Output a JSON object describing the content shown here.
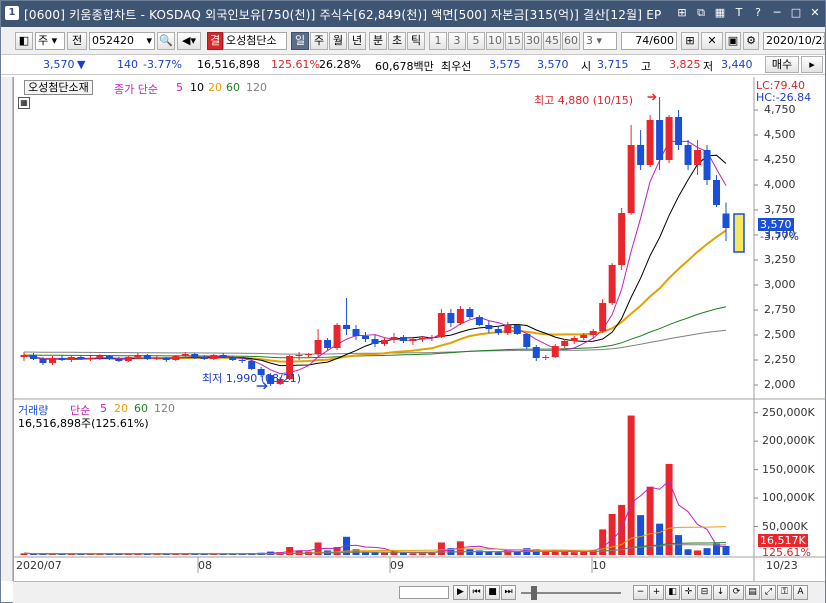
{
  "window": {
    "badge": "1",
    "title": "[0600] 키움종합차트 - KOSDAQ 외국인보유[750(천)] 주식수[62,849(천)] 액면[500] 자본금[315(억)] 결산[12월] EP"
  },
  "toolbar": {
    "market": "주",
    "prev_label": "전",
    "code": "052420",
    "stock_name": "오성첨단소",
    "name_prefix": "결",
    "periods": [
      "일",
      "주",
      "월",
      "년",
      "분",
      "초",
      "틱"
    ],
    "minutes": [
      "1",
      "3",
      "5",
      "10",
      "15",
      "30",
      "45",
      "60"
    ],
    "custom_value": "3",
    "count": "74/600",
    "date": "2020/10/23"
  },
  "quote": {
    "price": "3,570",
    "arrow": "▼",
    "change": "140",
    "change_pct": "-3.77%",
    "volume": "16,516,898",
    "vol_ratio": "125.61%",
    "turnover": "26.28%",
    "amount": "60,678백만",
    "pref_label": "최우선",
    "bid1": "3,575",
    "bid2": "3,570",
    "open_label": "시",
    "open": "3,715",
    "high_label": "고",
    "high": "3,825",
    "low_label": "저",
    "low": "3,440",
    "buy_label": "매수"
  },
  "price_panel": {
    "chip": "오성첨단소재",
    "legend_name": "종가 단순",
    "ma": [
      "5",
      "10",
      "20",
      "60",
      "120"
    ],
    "ma_colors": [
      "#c020c0",
      "#000000",
      "#e6a000",
      "#208020",
      "#808080"
    ],
    "lc": "LC:79.40",
    "hc": "HC:-26.84",
    "yticks": [
      "4,750",
      "4,500",
      "4,250",
      "4,000",
      "3,750",
      "3,500",
      "3,250",
      "3,000",
      "2,750",
      "2,500",
      "2,250",
      "2,000"
    ],
    "current_tag": "3,570",
    "current_pct": "-3.77%",
    "max_label": "최고 4,880 (10/15)",
    "min_label": "최저 1,990 (08/21)"
  },
  "volume_panel": {
    "legend_name": "거래량",
    "legend_ma": "단순",
    "ma": [
      "5",
      "20",
      "60",
      "120"
    ],
    "info": "16,516,898주(125.61%)",
    "yticks": [
      "250,000K",
      "200,000K",
      "150,000K",
      "100,000K",
      "50,000K"
    ],
    "current_tag": "16,517K",
    "current_pct": "125.61%"
  },
  "xaxis": {
    "labels": [
      "2020/07",
      "08",
      "09",
      "10",
      "10/23"
    ]
  },
  "colors": {
    "up": "#e8262b",
    "down": "#1a4fd8",
    "title_bg": "#3e5573"
  },
  "chart_data": {
    "type": "candlestick",
    "dates_from": "2020/07",
    "dates_to": "2020/10/23",
    "ohlc": [
      [
        2280,
        2330,
        2240,
        2300
      ],
      [
        2300,
        2320,
        2250,
        2260
      ],
      [
        2260,
        2280,
        2200,
        2220
      ],
      [
        2220,
        2290,
        2200,
        2270
      ],
      [
        2270,
        2300,
        2240,
        2250
      ],
      [
        2250,
        2290,
        2230,
        2280
      ],
      [
        2280,
        2300,
        2250,
        2260
      ],
      [
        2260,
        2290,
        2240,
        2270
      ],
      [
        2270,
        2310,
        2250,
        2290
      ],
      [
        2290,
        2300,
        2250,
        2260
      ],
      [
        2260,
        2280,
        2230,
        2240
      ],
      [
        2240,
        2290,
        2230,
        2280
      ],
      [
        2280,
        2320,
        2260,
        2300
      ],
      [
        2300,
        2310,
        2250,
        2260
      ],
      [
        2260,
        2290,
        2250,
        2270
      ],
      [
        2270,
        2280,
        2230,
        2250
      ],
      [
        2250,
        2300,
        2240,
        2290
      ],
      [
        2290,
        2330,
        2270,
        2310
      ],
      [
        2310,
        2320,
        2260,
        2280
      ],
      [
        2280,
        2300,
        2250,
        2260
      ],
      [
        2260,
        2310,
        2250,
        2300
      ],
      [
        2300,
        2320,
        2270,
        2280
      ],
      [
        2280,
        2290,
        2240,
        2250
      ],
      [
        2250,
        2280,
        2220,
        2240
      ],
      [
        2240,
        2260,
        2150,
        2160
      ],
      [
        2160,
        2180,
        2080,
        2100
      ],
      [
        2100,
        2120,
        1990,
        2010
      ],
      [
        2010,
        2080,
        2000,
        2060
      ],
      [
        2060,
        2300,
        2050,
        2290
      ],
      [
        2290,
        2330,
        2250,
        2300
      ],
      [
        2300,
        2320,
        2270,
        2310
      ],
      [
        2310,
        2560,
        2290,
        2450
      ],
      [
        2450,
        2470,
        2350,
        2370
      ],
      [
        2370,
        2620,
        2350,
        2600
      ],
      [
        2600,
        2870,
        2500,
        2560
      ],
      [
        2560,
        2600,
        2450,
        2490
      ],
      [
        2490,
        2530,
        2430,
        2460
      ],
      [
        2460,
        2500,
        2380,
        2410
      ],
      [
        2410,
        2470,
        2390,
        2450
      ],
      [
        2450,
        2520,
        2420,
        2480
      ],
      [
        2480,
        2500,
        2420,
        2440
      ],
      [
        2440,
        2470,
        2400,
        2460
      ],
      [
        2460,
        2490,
        2430,
        2470
      ],
      [
        2470,
        2500,
        2440,
        2480
      ],
      [
        2480,
        2760,
        2470,
        2720
      ],
      [
        2720,
        2760,
        2580,
        2620
      ],
      [
        2620,
        2790,
        2600,
        2760
      ],
      [
        2760,
        2780,
        2660,
        2680
      ],
      [
        2680,
        2700,
        2590,
        2600
      ],
      [
        2600,
        2640,
        2520,
        2560
      ],
      [
        2560,
        2590,
        2500,
        2520
      ],
      [
        2520,
        2630,
        2500,
        2600
      ],
      [
        2600,
        2610,
        2500,
        2510
      ],
      [
        2510,
        2520,
        2360,
        2380
      ],
      [
        2380,
        2400,
        2240,
        2270
      ],
      [
        2270,
        2300,
        2250,
        2280
      ],
      [
        2280,
        2410,
        2270,
        2390
      ],
      [
        2390,
        2460,
        2370,
        2440
      ],
      [
        2440,
        2490,
        2410,
        2470
      ],
      [
        2470,
        2520,
        2450,
        2500
      ],
      [
        2500,
        2560,
        2470,
        2540
      ],
      [
        2540,
        2860,
        2520,
        2820
      ],
      [
        2820,
        3220,
        2800,
        3200
      ],
      [
        3200,
        3770,
        3150,
        3720
      ],
      [
        3720,
        4600,
        3700,
        4400
      ],
      [
        4400,
        4550,
        4150,
        4200
      ],
      [
        4200,
        4700,
        4180,
        4650
      ],
      [
        4650,
        4880,
        4150,
        4250
      ],
      [
        4250,
        4700,
        4220,
        4680
      ],
      [
        4680,
        4750,
        4350,
        4400
      ],
      [
        4400,
        4450,
        4150,
        4200
      ],
      [
        4200,
        4450,
        4100,
        4350
      ],
      [
        4350,
        4400,
        4000,
        4050
      ],
      [
        4050,
        4100,
        3780,
        3800
      ],
      [
        3715,
        3825,
        3440,
        3570
      ]
    ],
    "volume_k": [
      3,
      2,
      2,
      2,
      2,
      2,
      2,
      2,
      2,
      2,
      2,
      2,
      2,
      2,
      2,
      2,
      2,
      2,
      2,
      2,
      2,
      2,
      2,
      2,
      3,
      4,
      6,
      5,
      14,
      8,
      6,
      22,
      8,
      14,
      32,
      10,
      6,
      5,
      4,
      5,
      4,
      3,
      3,
      4,
      22,
      12,
      24,
      10,
      8,
      6,
      5,
      8,
      6,
      12,
      10,
      6,
      8,
      6,
      5,
      6,
      8,
      45,
      72,
      88,
      245,
      70,
      120,
      55,
      160,
      35,
      10,
      8,
      12,
      20,
      16
    ],
    "ma_price": {
      "ma5_end": 4000,
      "ma10_end": 4000,
      "ma20_end": 3210,
      "ma60_end": 2640,
      "ma120_end": 2490
    },
    "ylim": [
      1900,
      4900
    ],
    "vol_ylim": [
      0,
      260000
    ]
  }
}
